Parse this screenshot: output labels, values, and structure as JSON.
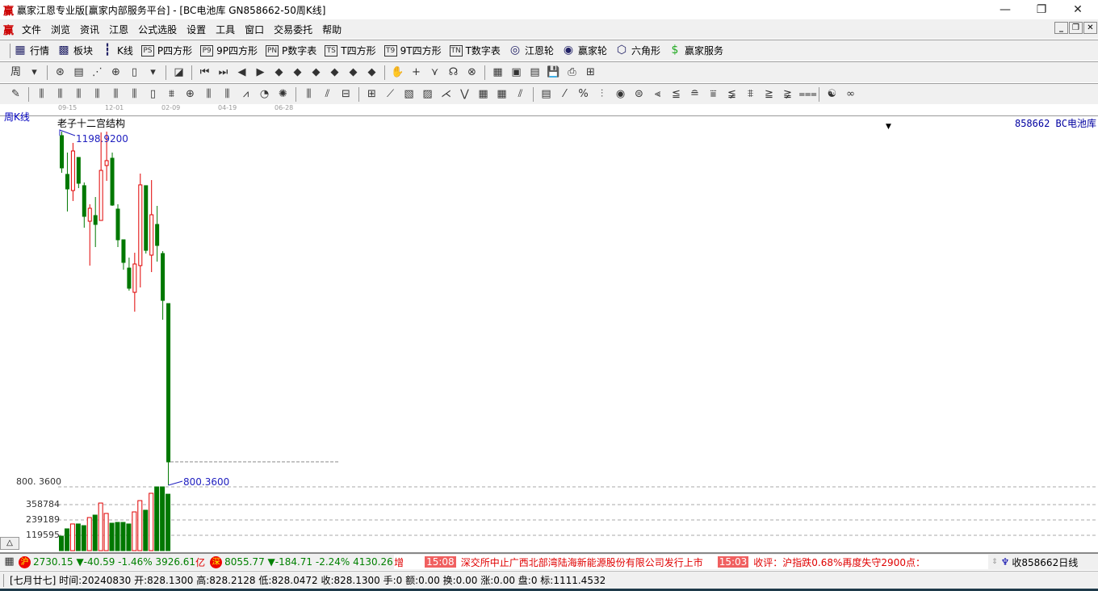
{
  "window": {
    "title": "赢家江恩专业版[赢家内部服务平台] - [BC电池库   GN858662-50周K线]",
    "logo": "赢",
    "minimize": "—",
    "restore": "❐",
    "close": "✕"
  },
  "menu": [
    "文件",
    "浏览",
    "资讯",
    "江恩",
    "公式选股",
    "设置",
    "工具",
    "窗口",
    "交易委托",
    "帮助"
  ],
  "toolbar1": [
    {
      "icon": "grid-icon",
      "glyph": "▦",
      "label": "行情"
    },
    {
      "icon": "blocks-icon",
      "glyph": "▩",
      "label": "板块"
    },
    {
      "icon": "candles-icon",
      "glyph": "┇",
      "label": "K线"
    },
    {
      "icon": "ps-icon",
      "glyph": "PS",
      "label": "P四方形"
    },
    {
      "icon": "p9-icon",
      "glyph": "P9",
      "label": "9P四方形"
    },
    {
      "icon": "pn-icon",
      "glyph": "PN",
      "label": "P数字表"
    },
    {
      "icon": "ts-icon",
      "glyph": "TS",
      "label": "T四方形"
    },
    {
      "icon": "t9-icon",
      "glyph": "T9",
      "label": "9T四方形"
    },
    {
      "icon": "tn-icon",
      "glyph": "TN",
      "label": "T数字表"
    },
    {
      "icon": "gann-wheel-icon",
      "glyph": "◎",
      "label": "江恩轮"
    },
    {
      "icon": "big-wheel-icon",
      "glyph": "◉",
      "label": "赢家轮"
    },
    {
      "icon": "hexagon-icon",
      "glyph": "⬡",
      "label": "六角形"
    },
    {
      "icon": "dollar-icon",
      "glyph": "$",
      "label": "赢家服务"
    }
  ],
  "chart": {
    "period_label": "周K线",
    "indicator_title": "老子十二宫结构",
    "symbol_label": "858662 BC电池库",
    "high_label": "1198.9200",
    "low_label": "800.3600",
    "axis_label_price": "800. 3600",
    "volume_ticks": [
      "358784",
      "239189",
      "119595"
    ],
    "date_ticks": [
      "09-15",
      "12-01",
      "02-09",
      "04-19",
      "06-28"
    ],
    "collapse_button": "△"
  },
  "chart_data": {
    "type": "candlestick",
    "price_range": [
      800.36,
      1198.92
    ],
    "colors": {
      "up": "#e00000",
      "down": "#007800",
      "annotation": "#2020c0"
    },
    "candles": [
      [
        1194.4,
        1198.9,
        1152.5,
        1158.0
      ],
      [
        1150.7,
        1175.3,
        1108.9,
        1134.3
      ],
      [
        1132.5,
        1186.2,
        1120.7,
        1177.1
      ],
      [
        1169.8,
        1169.8,
        1135.2,
        1140.7
      ],
      [
        1138.0,
        1141.6,
        1090.6,
        1103.4
      ],
      [
        1097.9,
        1117.0,
        1047.9,
        1112.5
      ],
      [
        1104.3,
        1125.2,
        1068.8,
        1094.3
      ],
      [
        1098.8,
        1198.0,
        1098.8,
        1155.2
      ],
      [
        1160.7,
        1198.9,
        1143.4,
        1166.2
      ],
      [
        1168.9,
        1175.3,
        1115.2,
        1116.1
      ],
      [
        1111.6,
        1117.0,
        1068.8,
        1077.0
      ],
      [
        1077.0,
        1077.0,
        1043.3,
        1051.5
      ],
      [
        1045.1,
        1056.9,
        1019.7,
        1022.4
      ],
      [
        1017.8,
        1062.4,
        996.0,
        1049.7
      ],
      [
        1047.9,
        1151.6,
        1023.3,
        1138.9
      ],
      [
        1138.0,
        1138.0,
        1061.5,
        1065.1
      ],
      [
        1059.7,
        1144.3,
        1040.6,
        1105.2
      ],
      [
        1094.3,
        1115.2,
        1052.4,
        1070.6
      ],
      [
        1061.5,
        1064.2,
        986.9,
        1008.7
      ],
      [
        1005.1,
        1005.1,
        800.36,
        826.7
      ]
    ],
    "volumes": [
      113000,
      170000,
      208000,
      208000,
      195000,
      258000,
      277000,
      371000,
      290000,
      214000,
      220000,
      220000,
      208000,
      302000,
      390000,
      315000,
      447000,
      497000,
      497000,
      440000
    ]
  },
  "ticker": {
    "sh_badge": "沪",
    "sh_text": "2730.15 ▼-40.59 -1.46% 3926.61",
    "sh_unit": "亿",
    "sz_badge": "深",
    "sz_text": "8055.77 ▼-184.71 -2.24% 4130.26",
    "news_prefix": "增",
    "news": [
      {
        "time": "15:08",
        "text": "深交所中止广西北部湾陆海新能源股份有限公司发行上市"
      },
      {
        "time": "15:03",
        "text": "收评：沪指跌0.68%再度失守2900点："
      }
    ],
    "right_text": "收858662日线"
  },
  "info": "[七月廿七] 时间:20240830 开:828.1300 高:828.2128 低:828.0472 收:828.1300 手:0 额:0.00 换:0.00 涨:0.00 盘:0 标:1111.4532"
}
